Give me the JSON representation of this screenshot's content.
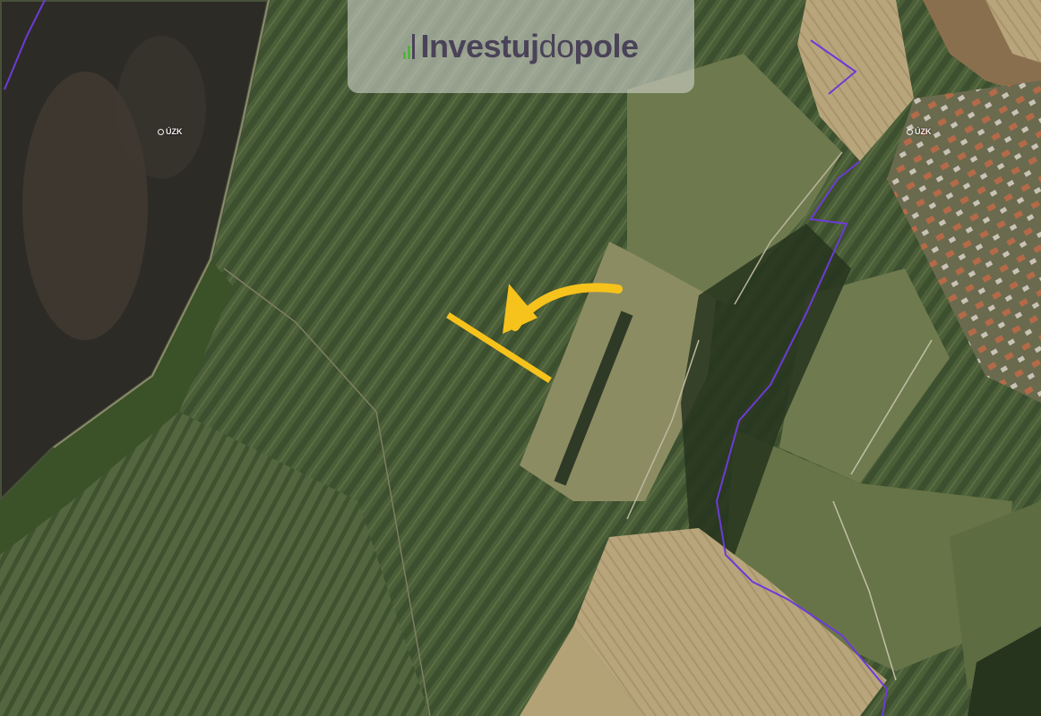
{
  "map": {
    "view": "satellite-cadastral",
    "colors": {
      "boundary": "#6d3bd8",
      "plot_highlight": "#f6c21c",
      "arrow": "#f6c21c",
      "field_green": "#465a35",
      "field_dark": "#2c2a25",
      "field_harvested": "#b6a27a"
    }
  },
  "brand": {
    "part1": "Investuj",
    "part2": "do",
    "part3": "pole",
    "mark_color": "#4fb43a"
  },
  "pins": [
    {
      "icon": "cadastral-pin-icon",
      "label": "ÚZK"
    },
    {
      "icon": "cadastral-pin-icon",
      "label": "ÚZK"
    }
  ]
}
